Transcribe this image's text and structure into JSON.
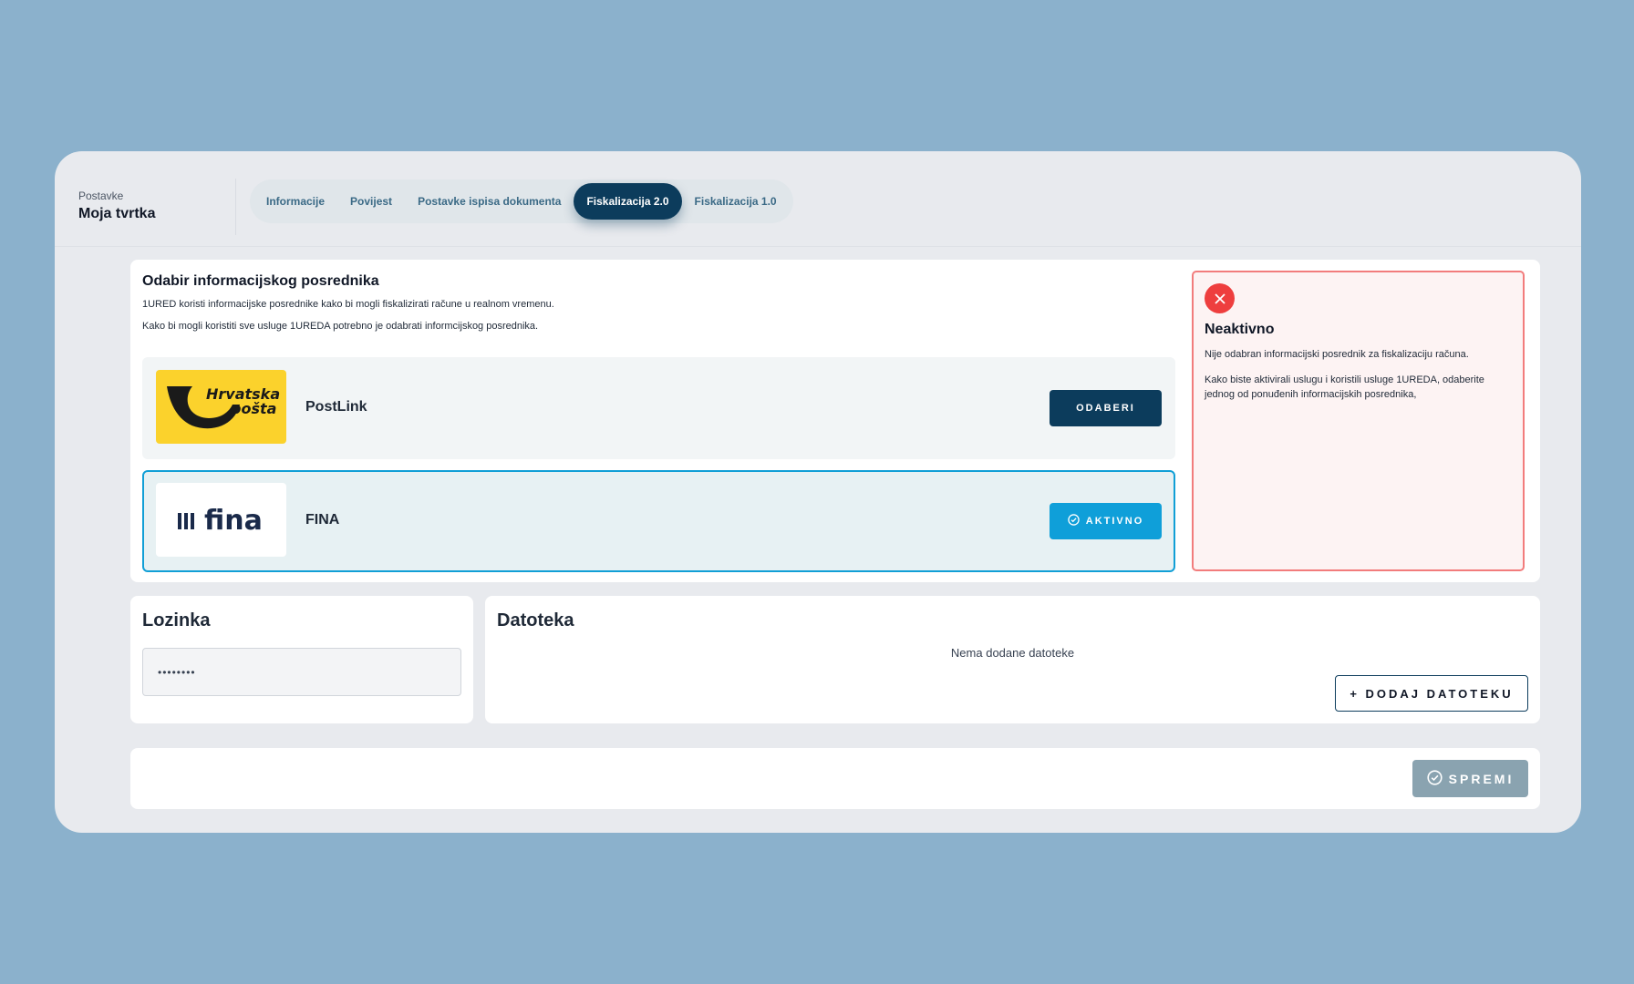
{
  "breadcrumb": {
    "parent": "Postavke",
    "title": "Moja tvrtka"
  },
  "tabs": [
    {
      "label": "Informacije",
      "active": false
    },
    {
      "label": "Povijest",
      "active": false
    },
    {
      "label": "Postavke ispisa dokumenta",
      "active": false
    },
    {
      "label": "Fiskalizacija 2.0",
      "active": true
    },
    {
      "label": "Fiskalizacija 1.0",
      "active": false
    }
  ],
  "selection": {
    "title": "Odabir informacijskog posrednika",
    "desc1": "1URED koristi informacijske posrednike kako bi mogli fiskalizirati račune u realnom vremenu.",
    "desc2": "Kako bi mogli koristiti sve usluge 1UREDA potrebno je odabrati informcijskog posrednika."
  },
  "providers": [
    {
      "name": "PostLink",
      "logo_text_1": "Hrvatska",
      "logo_text_2": "pošta",
      "button": "ODABERI",
      "logo_color": "#fbd22c"
    },
    {
      "name": "FINA",
      "logo_text": "fina",
      "button": "AKTIVNO"
    }
  ],
  "status": {
    "title": "Neaktivno",
    "text1": "Nije odabran informacijski posrednik za fiskalizaciju računa.",
    "text2": "Kako biste aktivirali uslugu i koristili usluge 1UREDA, odaberite jednog od ponuđenih informacijskih posrednika,",
    "icon": "close-icon",
    "color": "#ee3e3e"
  },
  "password": {
    "title": "Lozinka",
    "value": "••••••••"
  },
  "file": {
    "title": "Datoteka",
    "empty_text": "Nema dodane datoteke",
    "add_button": "+ DODAJ DATOTEKU"
  },
  "save": {
    "label": "SPREMI",
    "icon": "check-circle-icon"
  },
  "colors": {
    "background": "#8bb1cc",
    "primary": "#0c3c5c",
    "accent": "#0f9fd9",
    "danger": "#ee3e3e"
  }
}
